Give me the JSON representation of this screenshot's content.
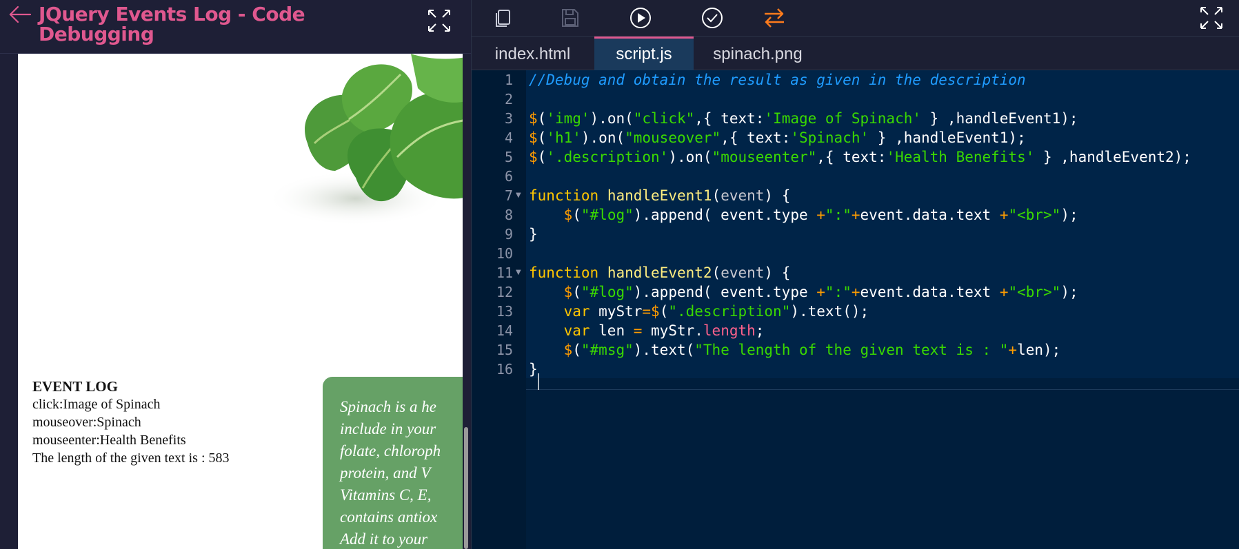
{
  "left": {
    "title": "JQuery Events Log - Code Debugging",
    "event_log": {
      "heading": "EVENT LOG",
      "lines": [
        "click:Image of Spinach",
        "mouseover:Spinach",
        "mouseenter:Health Benefits",
        "The length of the given text is : 583"
      ]
    },
    "description_lines": [
      "Spinach is a he",
      "include in your",
      "folate, chloroph",
      "protein,  and  V",
      "Vitamins C, E,",
      "contains antiox",
      "Add it to your"
    ]
  },
  "toolbar": {
    "icons": [
      "copy-icon",
      "save-icon",
      "run-icon",
      "check-icon",
      "swap-icon",
      "expand-icon"
    ],
    "colors": {
      "swap": "#ff7b1c",
      "save_disabled": "#5b5f75",
      "default": "#c8cbd8"
    }
  },
  "tabs": [
    {
      "label": "index.html",
      "active": false
    },
    {
      "label": "script.js",
      "active": true
    },
    {
      "label": "spinach.png",
      "active": false
    }
  ],
  "editor": {
    "line_numbers": [
      "1",
      "2",
      "3",
      "4",
      "5",
      "6",
      "7",
      "8",
      "9",
      "10",
      "11",
      "12",
      "13",
      "14",
      "15",
      "16"
    ],
    "lines": [
      "//Debug and obtain the result as given in the description",
      "",
      "$('img').on(\"click\",{ text:'Image of Spinach' } ,handleEvent1);",
      "$('h1').on(\"mouseover\",{ text:'Spinach' } ,handleEvent1);",
      "$('.description').on(\"mouseenter\",{ text:'Health Benefits' } ,handleEvent2);",
      "",
      "function handleEvent1(event) {",
      "    $(\"#log\").append( event.type +\":\"+event.data.text +\"<br>\");",
      "}",
      "",
      "function handleEvent2(event) {",
      "    $(\"#log\").append( event.type +\":\"+event.data.text +\"<br>\");",
      "    var myStr=$(\".description\").text();",
      "    var len = myStr.length;",
      "    $(\"#msg\").text(\"The length of the given text is : \"+len);",
      "}"
    ]
  },
  "colors": {
    "accent": "#e0588f",
    "editor_bg": "#001e3c",
    "header_bg": "#1e1f36",
    "description_box": "#66a166"
  }
}
